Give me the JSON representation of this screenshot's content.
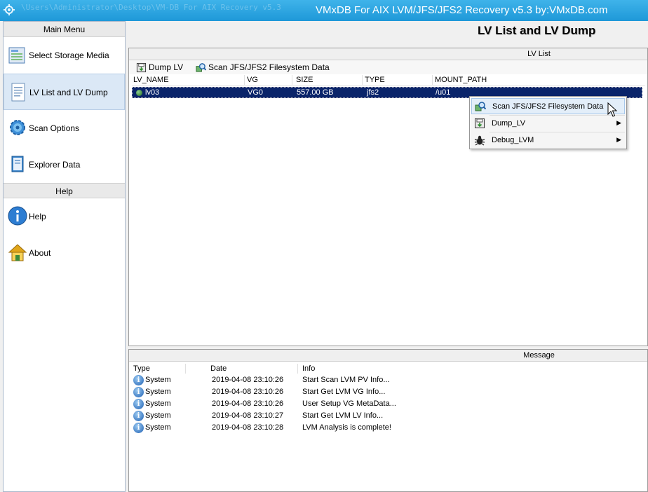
{
  "window": {
    "title": "VMxDB For AIX LVM/JFS/JFS2 Recovery v5.3 by:VMxDB.com",
    "faded_path": "\\Users\\Administrator\\Desktop\\VM-DB For AIX Recovery v5.3"
  },
  "sidebar": {
    "main_menu_header": "Main Menu",
    "help_header": "Help",
    "main_items": [
      {
        "label": "Select Storage Media",
        "icon": "storage-media-icon"
      },
      {
        "label": "LV List and LV Dump",
        "icon": "document-list-icon",
        "active": true
      },
      {
        "label": "Scan Options",
        "icon": "gear-icon"
      },
      {
        "label": "Explorer Data",
        "icon": "book-icon"
      }
    ],
    "help_items": [
      {
        "label": "Help",
        "icon": "info-icon"
      },
      {
        "label": "About",
        "icon": "home-icon"
      }
    ]
  },
  "main": {
    "title": "LV List and LV Dump"
  },
  "lv_list": {
    "panel_title": "LV List",
    "toolbar": {
      "dump_label": "Dump LV",
      "scan_label": "Scan JFS/JFS2 Filesystem Data"
    },
    "columns": [
      "LV_NAME",
      "VG",
      "SIZE",
      "TYPE",
      "MOUNT_PATH"
    ],
    "rows": [
      {
        "lv_name": "lv03",
        "vg": "VG0",
        "size": "557.00 GB",
        "type": "jfs2",
        "mount_path": "/u01"
      }
    ]
  },
  "context_menu": {
    "items": [
      {
        "label": "Scan JFS/JFS2 Filesystem Data",
        "icon": "scan-icon",
        "highlighted": true,
        "submenu": false
      },
      {
        "label": "Dump_LV",
        "icon": "dump-icon",
        "submenu": true
      },
      {
        "label": "Debug_LVM",
        "icon": "bug-icon",
        "submenu": true
      }
    ],
    "submenu_arrow": "▶"
  },
  "message": {
    "panel_title": "Message",
    "columns": [
      "Type",
      "Date",
      "Info"
    ],
    "rows": [
      {
        "type": "System",
        "date": "2019-04-08 23:10:26",
        "info": "Start Scan LVM PV Info..."
      },
      {
        "type": "System",
        "date": "2019-04-08 23:10:26",
        "info": "Start Get LVM VG Info..."
      },
      {
        "type": "System",
        "date": "2019-04-08 23:10:26",
        "info": "User Setup VG MetaData..."
      },
      {
        "type": "System",
        "date": "2019-04-08 23:10:27",
        "info": "Start Get LVM LV Info..."
      },
      {
        "type": "System",
        "date": "2019-04-08 23:10:28",
        "info": "LVM Analysis is complete!"
      }
    ],
    "info_glyph": "i"
  },
  "colors": {
    "titlebar": "#1e98d8",
    "selection": "#0a246a",
    "sidebar_active": "#dbe8f6"
  }
}
